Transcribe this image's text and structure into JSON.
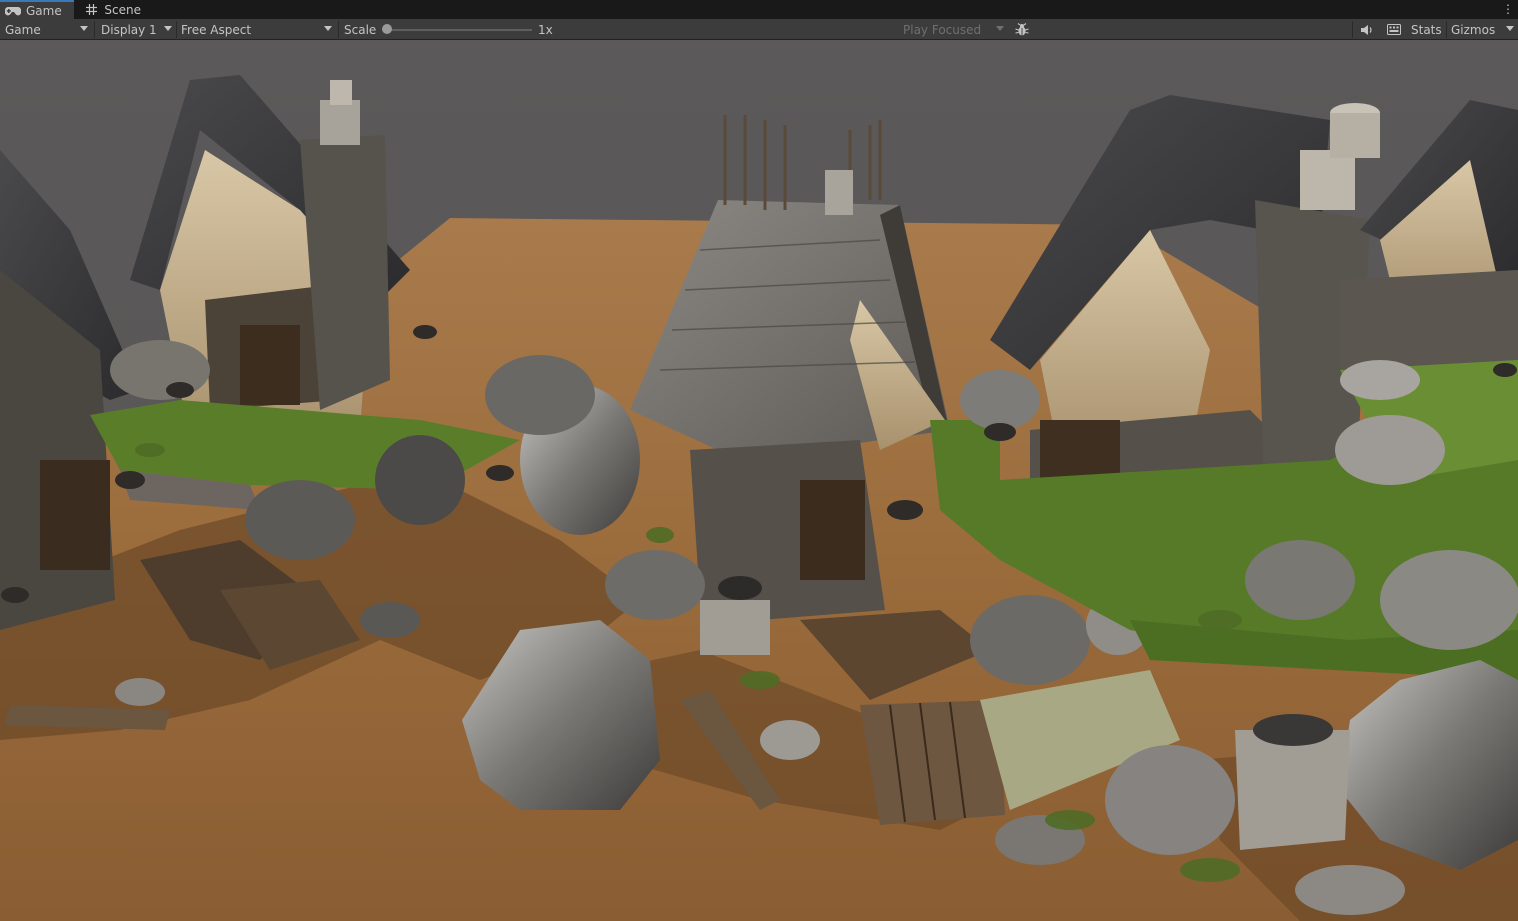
{
  "tabs": [
    {
      "label": "Game",
      "icon": "gamepad-icon",
      "active": true
    },
    {
      "label": "Scene",
      "icon": "grid-icon",
      "active": false
    }
  ],
  "toolbar": {
    "view_mode": "Game",
    "display": "Display 1",
    "aspect": "Free Aspect",
    "scale_label": "Scale",
    "scale_value": "1x",
    "scale_level": 0,
    "play_mode": "Play Focused",
    "stats_label": "Stats",
    "gizmos_label": "Gizmos"
  },
  "icons": [
    "gamepad-icon",
    "grid-icon",
    "bug-icon",
    "speaker-icon",
    "keyboard-icon",
    "kebab-menu-icon"
  ],
  "colors": {
    "tab_accent": "#3a79bb",
    "toolbar_bg": "#3c3c3c",
    "tabbar_bg": "#191919",
    "sky": "#5a5858",
    "ground": "#9c6c3c",
    "grass": "#5a7d2a"
  }
}
